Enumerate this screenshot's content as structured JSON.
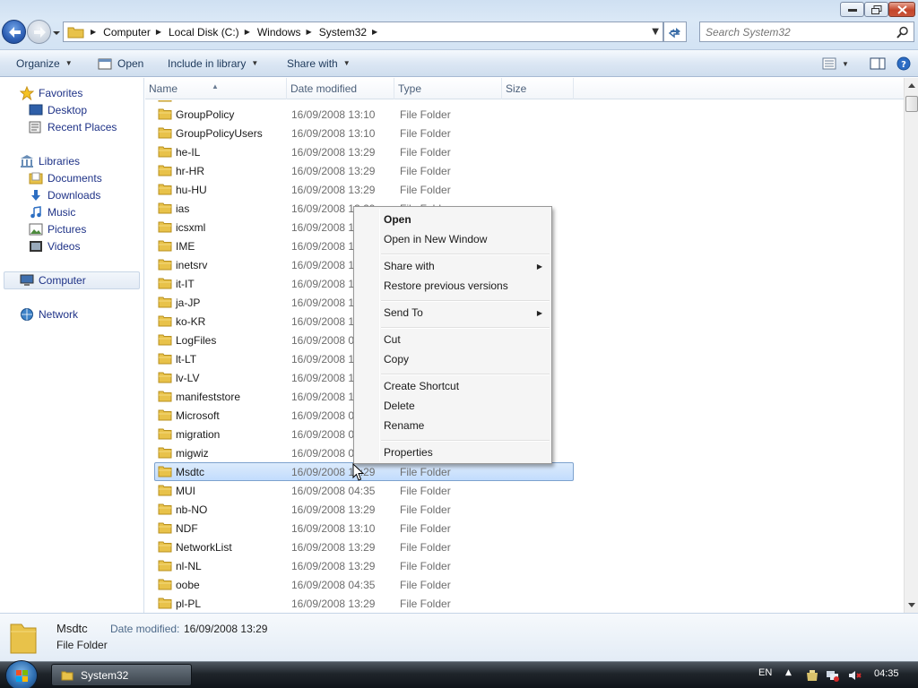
{
  "window": {
    "title_buttons": [
      "minimize",
      "maximize",
      "close"
    ]
  },
  "address": {
    "crumbs": [
      "Computer",
      "Local Disk (C:)",
      "Windows",
      "System32"
    ]
  },
  "search": {
    "placeholder": "Search System32"
  },
  "toolbar": {
    "organize": "Organize",
    "open": "Open",
    "include": "Include in library",
    "share": "Share with"
  },
  "nav": {
    "favorites": "Favorites",
    "desktop": "Desktop",
    "recent": "Recent Places",
    "libraries": "Libraries",
    "documents": "Documents",
    "downloads": "Downloads",
    "music": "Music",
    "pictures": "Pictures",
    "videos": "Videos",
    "computer": "Computer",
    "network": "Network"
  },
  "columns": {
    "name": "Name",
    "date": "Date modified",
    "type": "Type",
    "size": "Size"
  },
  "files": [
    {
      "name": "GroupPolicy",
      "date": "16/09/2008 13:10",
      "type": "File Folder"
    },
    {
      "name": "GroupPolicyUsers",
      "date": "16/09/2008 13:10",
      "type": "File Folder"
    },
    {
      "name": "he-IL",
      "date": "16/09/2008 13:29",
      "type": "File Folder"
    },
    {
      "name": "hr-HR",
      "date": "16/09/2008 13:29",
      "type": "File Folder"
    },
    {
      "name": "hu-HU",
      "date": "16/09/2008 13:29",
      "type": "File Folder"
    },
    {
      "name": "ias",
      "date": "16/09/2008 13:29",
      "type": "File Folder"
    },
    {
      "name": "icsxml",
      "date": "16/09/2008 1",
      "type": ""
    },
    {
      "name": "IME",
      "date": "16/09/2008 1",
      "type": ""
    },
    {
      "name": "inetsrv",
      "date": "16/09/2008 1",
      "type": ""
    },
    {
      "name": "it-IT",
      "date": "16/09/2008 1",
      "type": ""
    },
    {
      "name": "ja-JP",
      "date": "16/09/2008 1",
      "type": ""
    },
    {
      "name": "ko-KR",
      "date": "16/09/2008 1",
      "type": ""
    },
    {
      "name": "LogFiles",
      "date": "16/09/2008 0",
      "type": ""
    },
    {
      "name": "lt-LT",
      "date": "16/09/2008 1",
      "type": ""
    },
    {
      "name": "lv-LV",
      "date": "16/09/2008 1",
      "type": ""
    },
    {
      "name": "manifeststore",
      "date": "16/09/2008 1",
      "type": ""
    },
    {
      "name": "Microsoft",
      "date": "16/09/2008 0",
      "type": ""
    },
    {
      "name": "migration",
      "date": "16/09/2008 0",
      "type": ""
    },
    {
      "name": "migwiz",
      "date": "16/09/2008 0",
      "type": ""
    },
    {
      "name": "Msdtc",
      "date": "16/09/2008 13:29",
      "type": "File Folder",
      "selected": true
    },
    {
      "name": "MUI",
      "date": "16/09/2008 04:35",
      "type": "File Folder"
    },
    {
      "name": "nb-NO",
      "date": "16/09/2008 13:29",
      "type": "File Folder"
    },
    {
      "name": "NDF",
      "date": "16/09/2008 13:10",
      "type": "File Folder"
    },
    {
      "name": "NetworkList",
      "date": "16/09/2008 13:29",
      "type": "File Folder"
    },
    {
      "name": "nl-NL",
      "date": "16/09/2008 13:29",
      "type": "File Folder"
    },
    {
      "name": "oobe",
      "date": "16/09/2008 04:35",
      "type": "File Folder"
    },
    {
      "name": "pl-PL",
      "date": "16/09/2008 13:29",
      "type": "File Folder"
    }
  ],
  "context_menu": {
    "open": "Open",
    "open_new": "Open in New Window",
    "share": "Share with",
    "restore": "Restore previous versions",
    "send_to": "Send To",
    "cut": "Cut",
    "copy": "Copy",
    "create_shortcut": "Create Shortcut",
    "delete": "Delete",
    "rename": "Rename",
    "properties": "Properties"
  },
  "details": {
    "name": "Msdtc",
    "modified_label": "Date modified:",
    "modified_value": "16/09/2008 13:29",
    "type": "File Folder"
  },
  "taskbar": {
    "window_label": "System32",
    "lang": "EN",
    "clock": "04:35"
  },
  "colors": {
    "accent": "#1e3287",
    "selection": "#c2dcfd",
    "folder": "#e8c24a"
  }
}
